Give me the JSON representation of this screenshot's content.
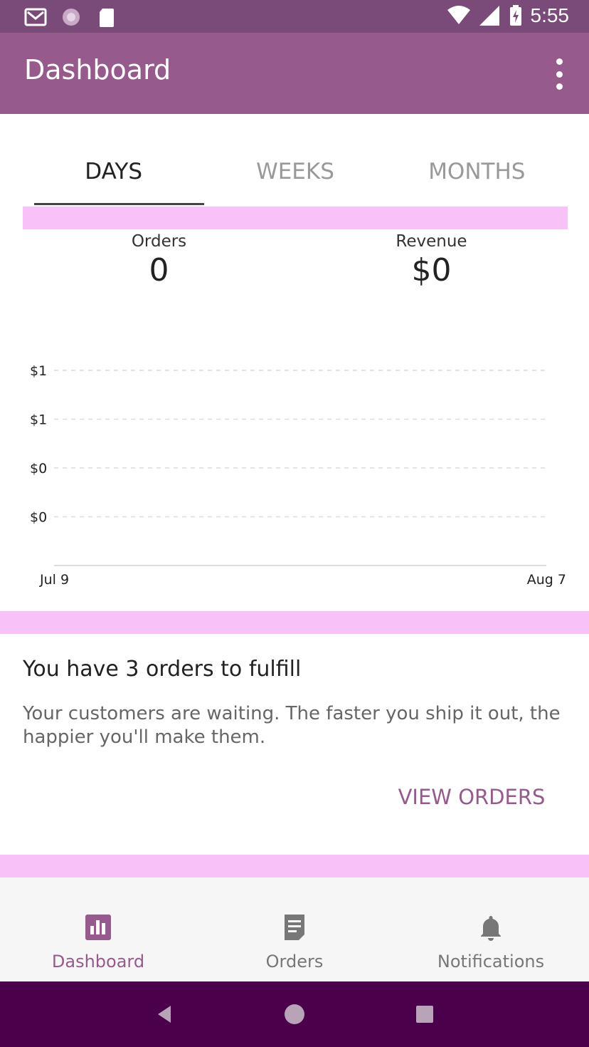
{
  "status_bar": {
    "time": "5:55",
    "icons": [
      "mail-icon",
      "sync-icon",
      "sd-card-icon",
      "wifi-icon",
      "signal-icon",
      "battery-charging-icon"
    ]
  },
  "app_bar": {
    "title": "Dashboard",
    "menu_icon": "more-vert-icon"
  },
  "tabs": [
    {
      "label": "DAYS",
      "active": true
    },
    {
      "label": "WEEKS",
      "active": false
    },
    {
      "label": "MONTHS",
      "active": false
    }
  ],
  "stats": {
    "orders": {
      "label": "Orders",
      "value": "0"
    },
    "revenue": {
      "label": "Revenue",
      "value": "$0"
    }
  },
  "chart_data": {
    "type": "line",
    "y_tick_labels": [
      "$1",
      "$1",
      "$0",
      "$0"
    ],
    "x_tick_labels": [
      "Jul 9",
      "Aug 7"
    ],
    "series": [],
    "grid": "dashed horizontal"
  },
  "orders_card": {
    "title": "You have 3 orders to fulfill",
    "description": "Your customers are waiting. The faster you ship it out, the happier you'll make them.",
    "button": "VIEW ORDERS"
  },
  "bottom_nav": [
    {
      "label": "Dashboard",
      "icon": "bar-chart-icon",
      "active": true
    },
    {
      "label": "Orders",
      "icon": "receipt-icon",
      "active": false
    },
    {
      "label": "Notifications",
      "icon": "bell-icon",
      "active": false
    }
  ],
  "colors": {
    "primary": "#965a8c",
    "status_bar": "#7a4a78",
    "system_nav": "#4a004a"
  }
}
